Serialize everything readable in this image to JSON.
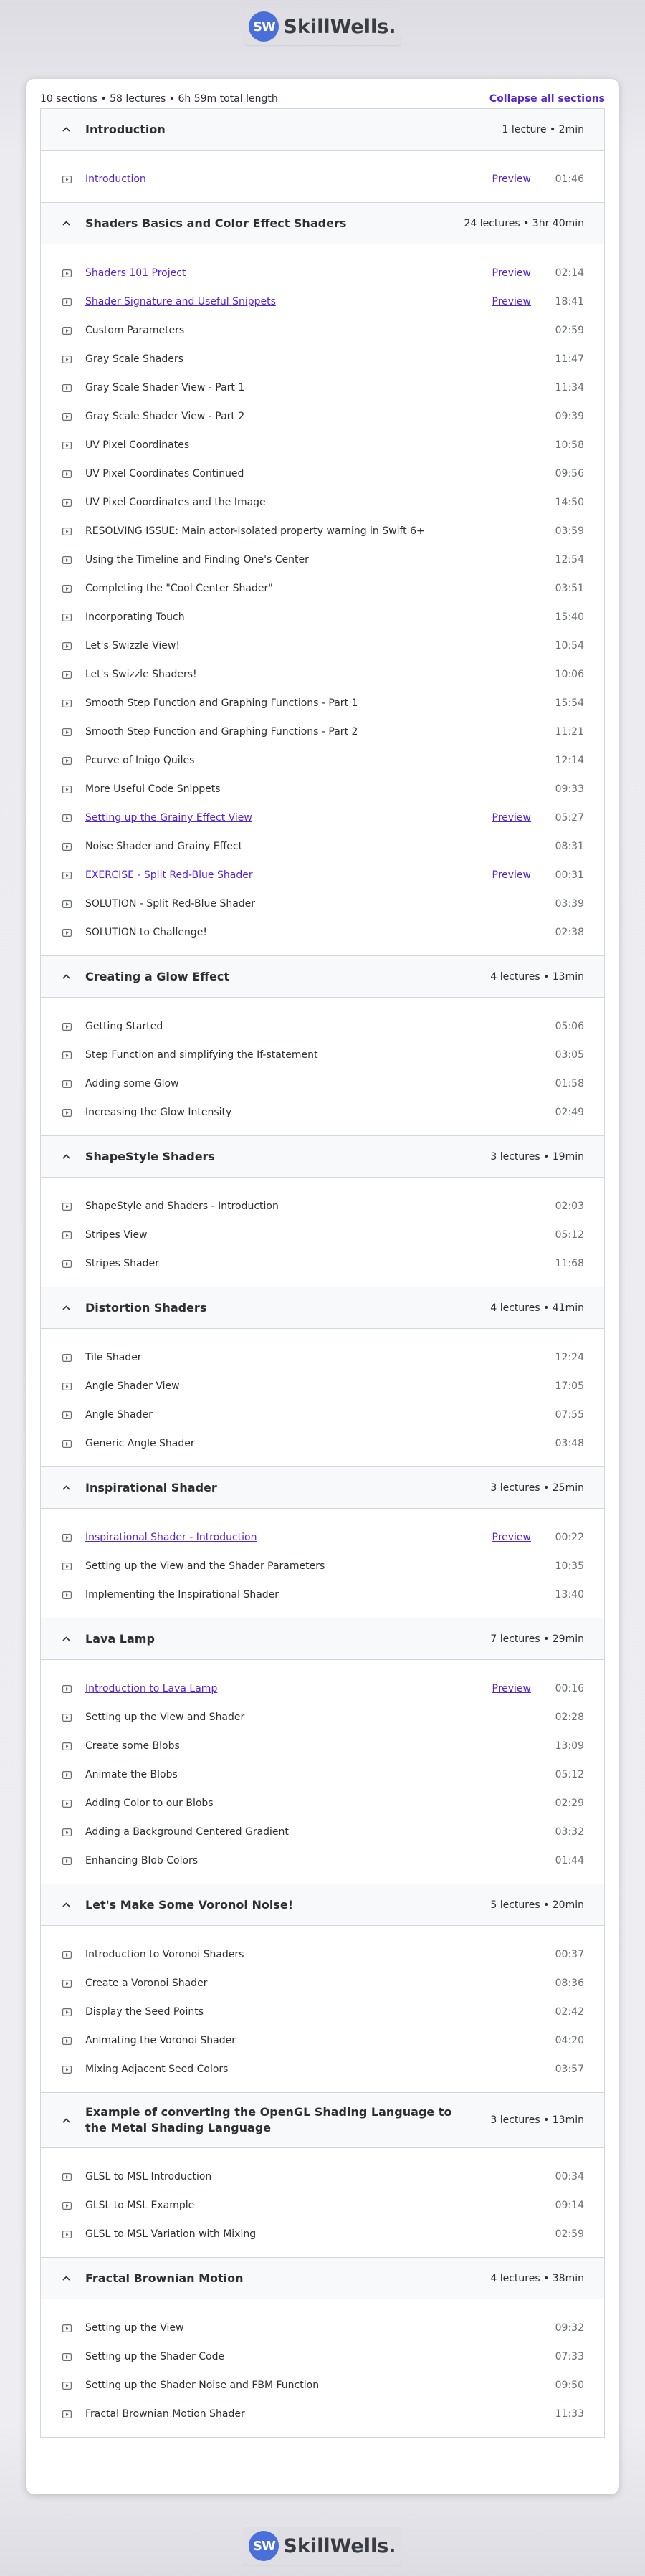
{
  "brand": {
    "mark": "SW",
    "name": "SkillWells."
  },
  "summary": {
    "text": "10 sections • 58 lectures • 6h 59m total length",
    "collapse_label": "Collapse all sections"
  },
  "sections": [
    {
      "title": "Introduction",
      "meta": "1 lecture • 2min",
      "lectures": [
        {
          "title": "Introduction",
          "preview": "Preview",
          "duration": "01:46"
        }
      ]
    },
    {
      "title": "Shaders Basics and Color Effect Shaders",
      "meta": "24 lectures • 3hr 40min",
      "lectures": [
        {
          "title": "Shaders 101 Project",
          "preview": "Preview",
          "duration": "02:14"
        },
        {
          "title": "Shader Signature and Useful Snippets",
          "preview": "Preview",
          "duration": "18:41"
        },
        {
          "title": "Custom Parameters",
          "duration": "02:59"
        },
        {
          "title": "Gray Scale Shaders",
          "duration": "11:47"
        },
        {
          "title": "Gray Scale Shader View - Part 1",
          "duration": "11:34"
        },
        {
          "title": "Gray Scale Shader View - Part 2",
          "duration": "09:39"
        },
        {
          "title": "UV Pixel Coordinates",
          "duration": "10:58"
        },
        {
          "title": "UV Pixel Coordinates Continued",
          "duration": "09:56"
        },
        {
          "title": "UV Pixel Coordinates and the Image",
          "duration": "14:50"
        },
        {
          "title": "RESOLVING ISSUE: Main actor-isolated property warning in Swift 6+",
          "duration": "03:59"
        },
        {
          "title": "Using the Timeline and Finding One's Center",
          "duration": "12:54"
        },
        {
          "title": "Completing the \"Cool Center Shader\"",
          "duration": "03:51"
        },
        {
          "title": "Incorporating Touch",
          "duration": "15:40"
        },
        {
          "title": "Let's Swizzle View!",
          "duration": "10:54"
        },
        {
          "title": "Let's Swizzle Shaders!",
          "duration": "10:06"
        },
        {
          "title": "Smooth Step Function and Graphing Functions - Part 1",
          "duration": "15:54"
        },
        {
          "title": "Smooth Step Function and Graphing Functions - Part 2",
          "duration": "11:21"
        },
        {
          "title": "Pcurve of Inigo Quiles",
          "duration": "12:14"
        },
        {
          "title": "More Useful Code Snippets",
          "duration": "09:33"
        },
        {
          "title": "Setting up the Grainy Effect View",
          "preview": "Preview",
          "duration": "05:27"
        },
        {
          "title": "Noise Shader and Grainy Effect",
          "duration": "08:31"
        },
        {
          "title": "EXERCISE - Split Red-Blue Shader",
          "preview": "Preview",
          "duration": "00:31"
        },
        {
          "title": "SOLUTION - Split Red-Blue Shader",
          "duration": "03:39"
        },
        {
          "title": "SOLUTION to Challenge!",
          "duration": "02:38"
        }
      ]
    },
    {
      "title": "Creating a Glow Effect",
      "meta": "4 lectures • 13min",
      "lectures": [
        {
          "title": "Getting Started",
          "duration": "05:06"
        },
        {
          "title": "Step Function and simplifying the If-statement",
          "duration": "03:05"
        },
        {
          "title": "Adding some Glow",
          "duration": "01:58"
        },
        {
          "title": "Increasing the Glow Intensity",
          "duration": "02:49"
        }
      ]
    },
    {
      "title": "ShapeStyle Shaders",
      "meta": "3 lectures • 19min",
      "lectures": [
        {
          "title": "ShapeStyle and Shaders - Introduction",
          "duration": "02:03"
        },
        {
          "title": "Stripes View",
          "duration": "05:12"
        },
        {
          "title": "Stripes Shader",
          "duration": "11:68"
        }
      ]
    },
    {
      "title": "Distortion Shaders",
      "meta": "4 lectures • 41min",
      "lectures": [
        {
          "title": "Tile Shader",
          "duration": "12:24"
        },
        {
          "title": "Angle Shader View",
          "duration": "17:05"
        },
        {
          "title": "Angle Shader",
          "duration": "07:55"
        },
        {
          "title": "Generic Angle Shader",
          "duration": "03:48"
        }
      ]
    },
    {
      "title": "Inspirational Shader",
      "meta": "3 lectures • 25min",
      "lectures": [
        {
          "title": "Inspirational Shader - Introduction",
          "preview": "Preview",
          "duration": "00:22"
        },
        {
          "title": "Setting up the View and the Shader Parameters",
          "duration": "10:35"
        },
        {
          "title": "Implementing the Inspirational Shader",
          "duration": "13:40"
        }
      ]
    },
    {
      "title": "Lava Lamp",
      "meta": "7 lectures • 29min",
      "lectures": [
        {
          "title": "Introduction to Lava Lamp",
          "preview": "Preview",
          "duration": "00:16"
        },
        {
          "title": "Setting up the View and Shader",
          "duration": "02:28"
        },
        {
          "title": "Create some Blobs",
          "duration": "13:09"
        },
        {
          "title": "Animate the Blobs",
          "duration": "05:12"
        },
        {
          "title": "Adding Color to our Blobs",
          "duration": "02:29"
        },
        {
          "title": "Adding a Background Centered Gradient",
          "duration": "03:32"
        },
        {
          "title": "Enhancing Blob Colors",
          "duration": "01:44"
        }
      ]
    },
    {
      "title": "Let's Make Some Voronoi Noise!",
      "meta": "5 lectures • 20min",
      "lectures": [
        {
          "title": "Introduction to Voronoi Shaders",
          "duration": "00:37"
        },
        {
          "title": "Create a Voronoi Shader",
          "duration": "08:36"
        },
        {
          "title": "Display the Seed Points",
          "duration": "02:42"
        },
        {
          "title": "Animating the Voronoi Shader",
          "duration": "04:20"
        },
        {
          "title": "Mixing Adjacent Seed Colors",
          "duration": "03:57"
        }
      ]
    },
    {
      "title": "Example of converting the OpenGL Shading Language to the Metal Shading Language",
      "meta": "3 lectures • 13min",
      "tall": true,
      "lectures": [
        {
          "title": "GLSL to MSL Introduction",
          "duration": "00:34"
        },
        {
          "title": "GLSL to MSL Example",
          "duration": "09:14"
        },
        {
          "title": "GLSL to MSL Variation with Mixing",
          "duration": "02:59"
        }
      ]
    },
    {
      "title": "Fractal Brownian Motion",
      "meta": "4 lectures • 38min",
      "lectures": [
        {
          "title": "Setting up the View",
          "duration": "09:32"
        },
        {
          "title": "Setting up the Shader Code",
          "duration": "07:33"
        },
        {
          "title": "Setting up the Shader Noise and FBM Function",
          "duration": "09:50"
        },
        {
          "title": "Fractal Brownian Motion Shader",
          "duration": "11:33"
        }
      ]
    }
  ]
}
